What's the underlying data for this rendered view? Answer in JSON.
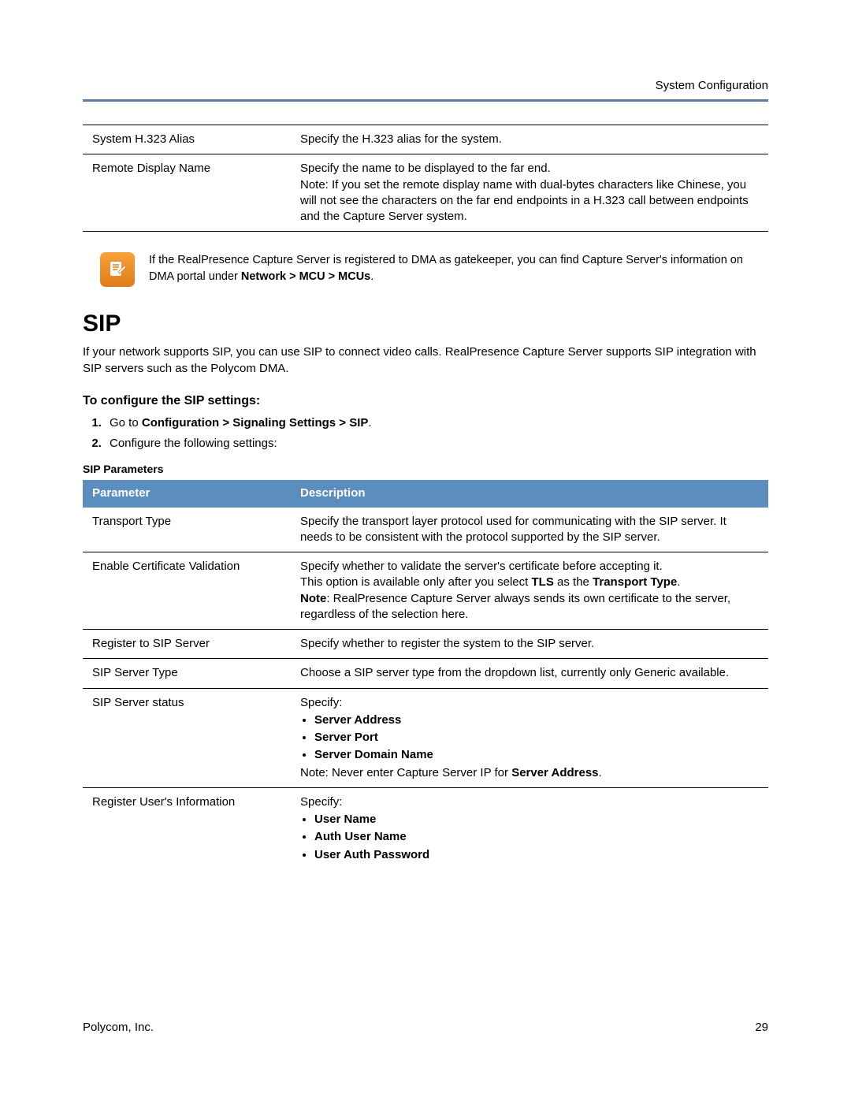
{
  "header": {
    "right": "System Configuration"
  },
  "top_table": {
    "rows": [
      {
        "param": "System H.323 Alias",
        "desc": "Specify the H.323 alias for the system."
      },
      {
        "param": "Remote Display Name",
        "desc_line1": "Specify the name to be displayed to the far end.",
        "desc_line2": "Note: If you set the remote display name with dual-bytes characters like Chinese, you will not see the characters on the far end endpoints in a H.323 call between endpoints and the Capture Server system."
      }
    ]
  },
  "note": {
    "text_pre": "If the RealPresence Capture Server is registered to DMA as gatekeeper, you can find Capture Server's information on DMA portal under ",
    "text_bold": "Network > MCU > MCUs",
    "text_post": "."
  },
  "sip": {
    "heading": "SIP",
    "intro": "If your network supports SIP, you can use SIP to connect video calls. RealPresence Capture Server supports SIP integration with SIP servers such as the Polycom DMA.",
    "subheading": "To configure the SIP settings:",
    "steps": {
      "s1_pre": "Go to ",
      "s1_bold": "Configuration > Signaling Settings > SIP",
      "s1_post": ".",
      "s2": "Configure the following settings:"
    },
    "table_caption": "SIP Parameters",
    "th1": "Parameter",
    "th2": "Description",
    "rows": {
      "r1": {
        "param": "Transport Type",
        "desc": "Specify the transport layer protocol used for communicating with the SIP server. It needs to be consistent with the protocol supported by the SIP server."
      },
      "r2": {
        "param": "Enable Certificate Validation",
        "l1": "Specify whether to validate the server's certificate before accepting it.",
        "l2a": "This option is available only after you select ",
        "l2b": "TLS",
        "l2c": " as the ",
        "l2d": "Transport Type",
        "l2e": ".",
        "l3a": "Note",
        "l3b": ": RealPresence Capture Server always sends its own certificate to the server, regardless of the selection here."
      },
      "r3": {
        "param": "Register to SIP Server",
        "desc": "Specify whether to register the system to the SIP server."
      },
      "r4": {
        "param": "SIP Server Type",
        "desc": "Choose a SIP server type from the dropdown list, currently only Generic available."
      },
      "r5": {
        "param": "SIP Server status",
        "lead": "Specify:",
        "b1": "Server Address",
        "b2": "Server Port",
        "b3": "Server Domain Name",
        "note_a": "Note: Never enter Capture Server IP for ",
        "note_b": "Server Address",
        "note_c": "."
      },
      "r6": {
        "param": "Register User's Information",
        "lead": "Specify:",
        "b1": "User Name",
        "b2": "Auth User Name",
        "b3": "User Auth Password"
      }
    }
  },
  "footer": {
    "left": "Polycom, Inc.",
    "right": "29"
  }
}
